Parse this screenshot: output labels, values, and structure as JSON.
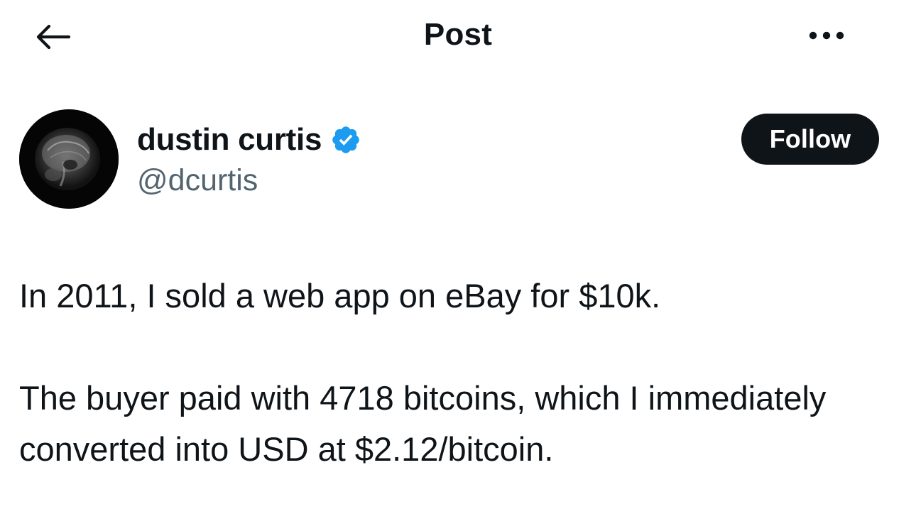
{
  "header": {
    "title": "Post",
    "back_icon": "arrow-left-icon",
    "more_icon": "more-horizontal-icon"
  },
  "author": {
    "display_name": "dustin curtis",
    "handle": "@dcurtis",
    "verified": true,
    "verified_color": "#1d9bf0",
    "follow_label": "Follow"
  },
  "post": {
    "paragraphs": [
      "In 2011, I sold a web app on eBay for $10k.",
      "The buyer paid with 4718 bitcoins, which I immediately converted into USD at $2.12/bitcoin."
    ]
  },
  "colors": {
    "text": "#0f1419",
    "secondary_text": "#536471",
    "follow_bg": "#0f1419",
    "follow_text": "#ffffff",
    "background": "#ffffff"
  }
}
